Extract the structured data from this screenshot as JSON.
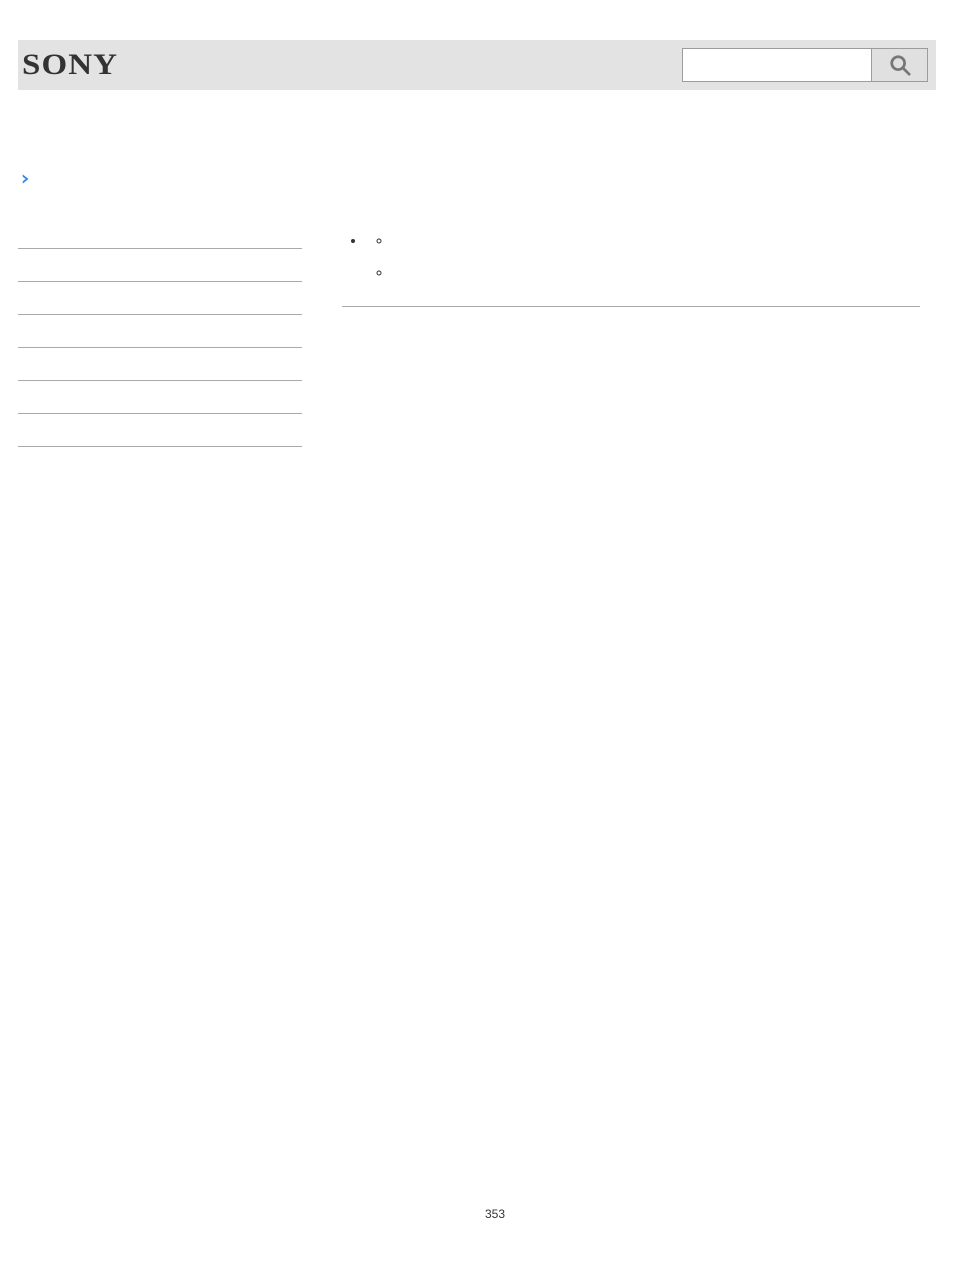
{
  "header": {
    "logo_text": "SONY",
    "search_value": "",
    "search_placeholder": ""
  },
  "back": {
    "label": ""
  },
  "sidebar": {
    "items": [
      {
        "label": ""
      },
      {
        "label": ""
      },
      {
        "label": ""
      },
      {
        "label": ""
      },
      {
        "label": ""
      },
      {
        "label": ""
      },
      {
        "label": ""
      }
    ]
  },
  "content": {
    "bullets": [
      {
        "label": "",
        "sub": [
          {
            "label": ""
          },
          {
            "label": ""
          }
        ]
      }
    ]
  },
  "footer": {
    "page_number": "353"
  }
}
